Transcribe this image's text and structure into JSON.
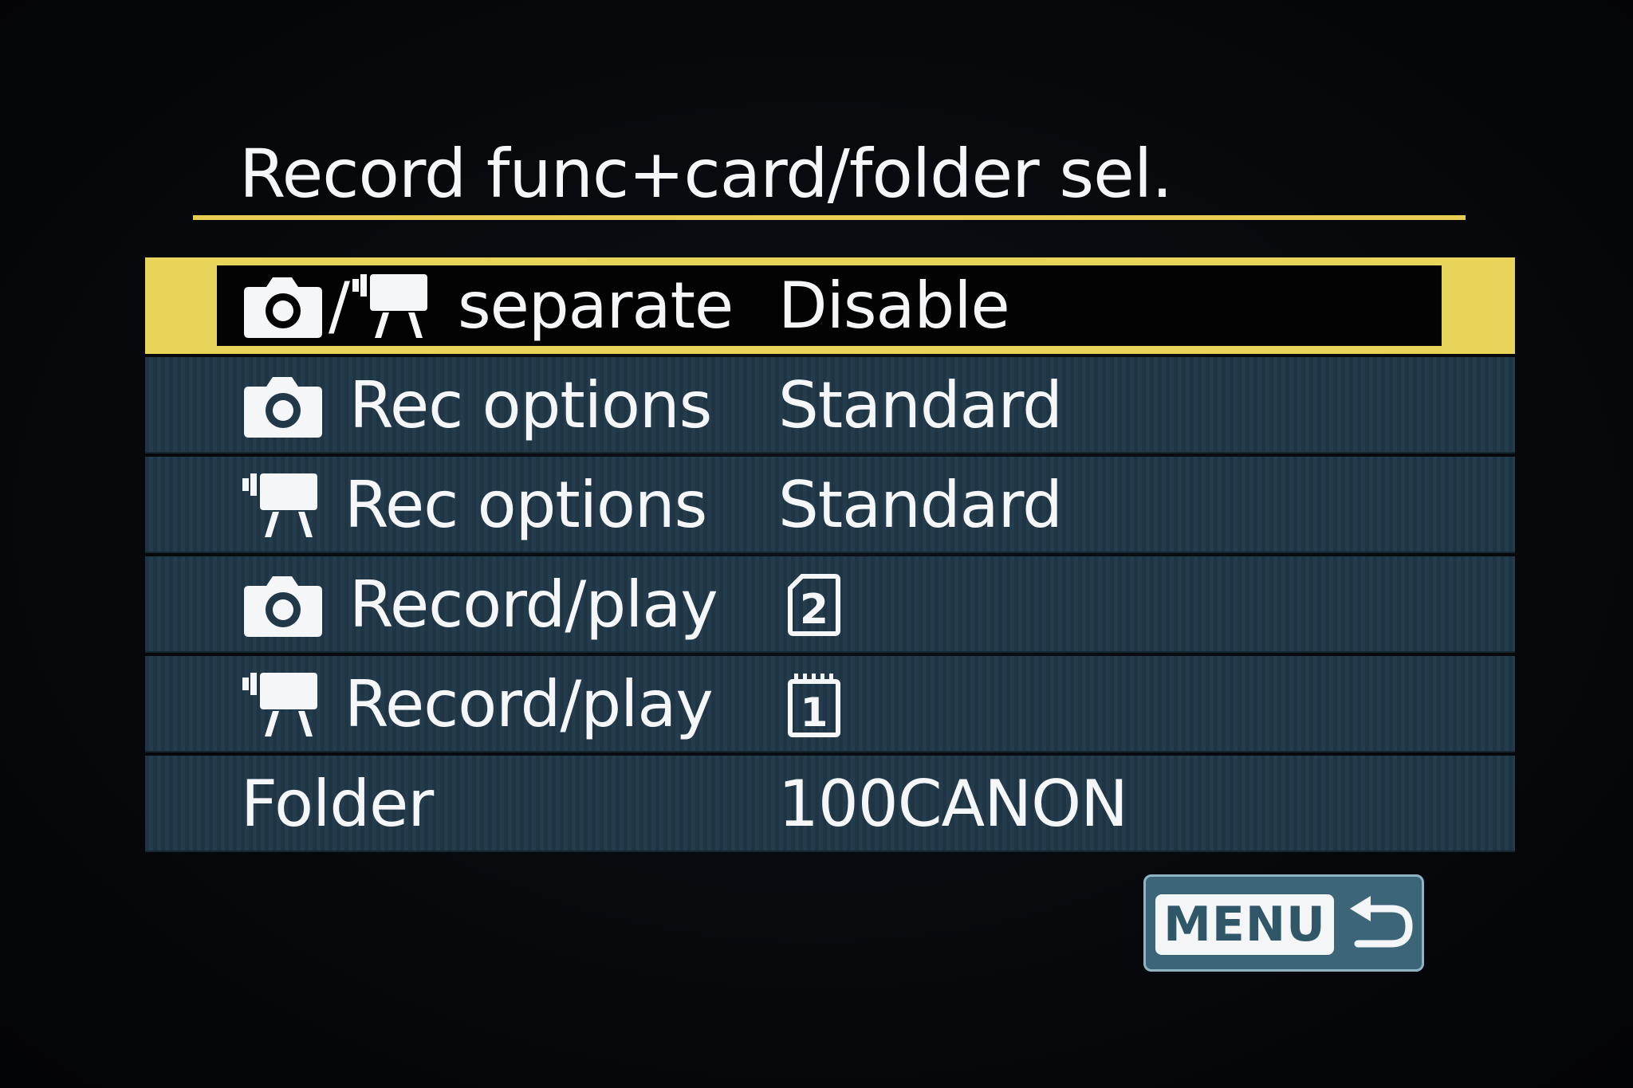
{
  "screen": {
    "title": "Record func+card/folder sel."
  },
  "rows": [
    {
      "icons": [
        "photo-camera-icon",
        "movie-camera-icon"
      ],
      "separator": "/",
      "label": "separate",
      "value": "Disable",
      "selected": true
    },
    {
      "icons": [
        "photo-camera-icon"
      ],
      "label": "Rec options",
      "value": "Standard",
      "selected": false
    },
    {
      "icons": [
        "movie-camera-icon"
      ],
      "label": "Rec options",
      "value": "Standard",
      "selected": false
    },
    {
      "icons": [
        "photo-camera-icon"
      ],
      "label": "Record/play",
      "value": "2",
      "value_icon": "sd-card-slot-icon",
      "selected": false
    },
    {
      "icons": [
        "movie-camera-icon"
      ],
      "label": "Record/play",
      "value": "1",
      "value_icon": "cf-card-slot-icon",
      "selected": false
    },
    {
      "icons": [],
      "label": "Folder",
      "value": "100CANON",
      "selected": false
    }
  ],
  "footer": {
    "menu_button": {
      "label": "MENU",
      "icon": "return-arrow-icon"
    }
  },
  "colors": {
    "background": "#05060a",
    "row": "#213849",
    "highlight": "#e8d35b",
    "text": "#f4f6f8",
    "menu_button": "#3c6678"
  }
}
